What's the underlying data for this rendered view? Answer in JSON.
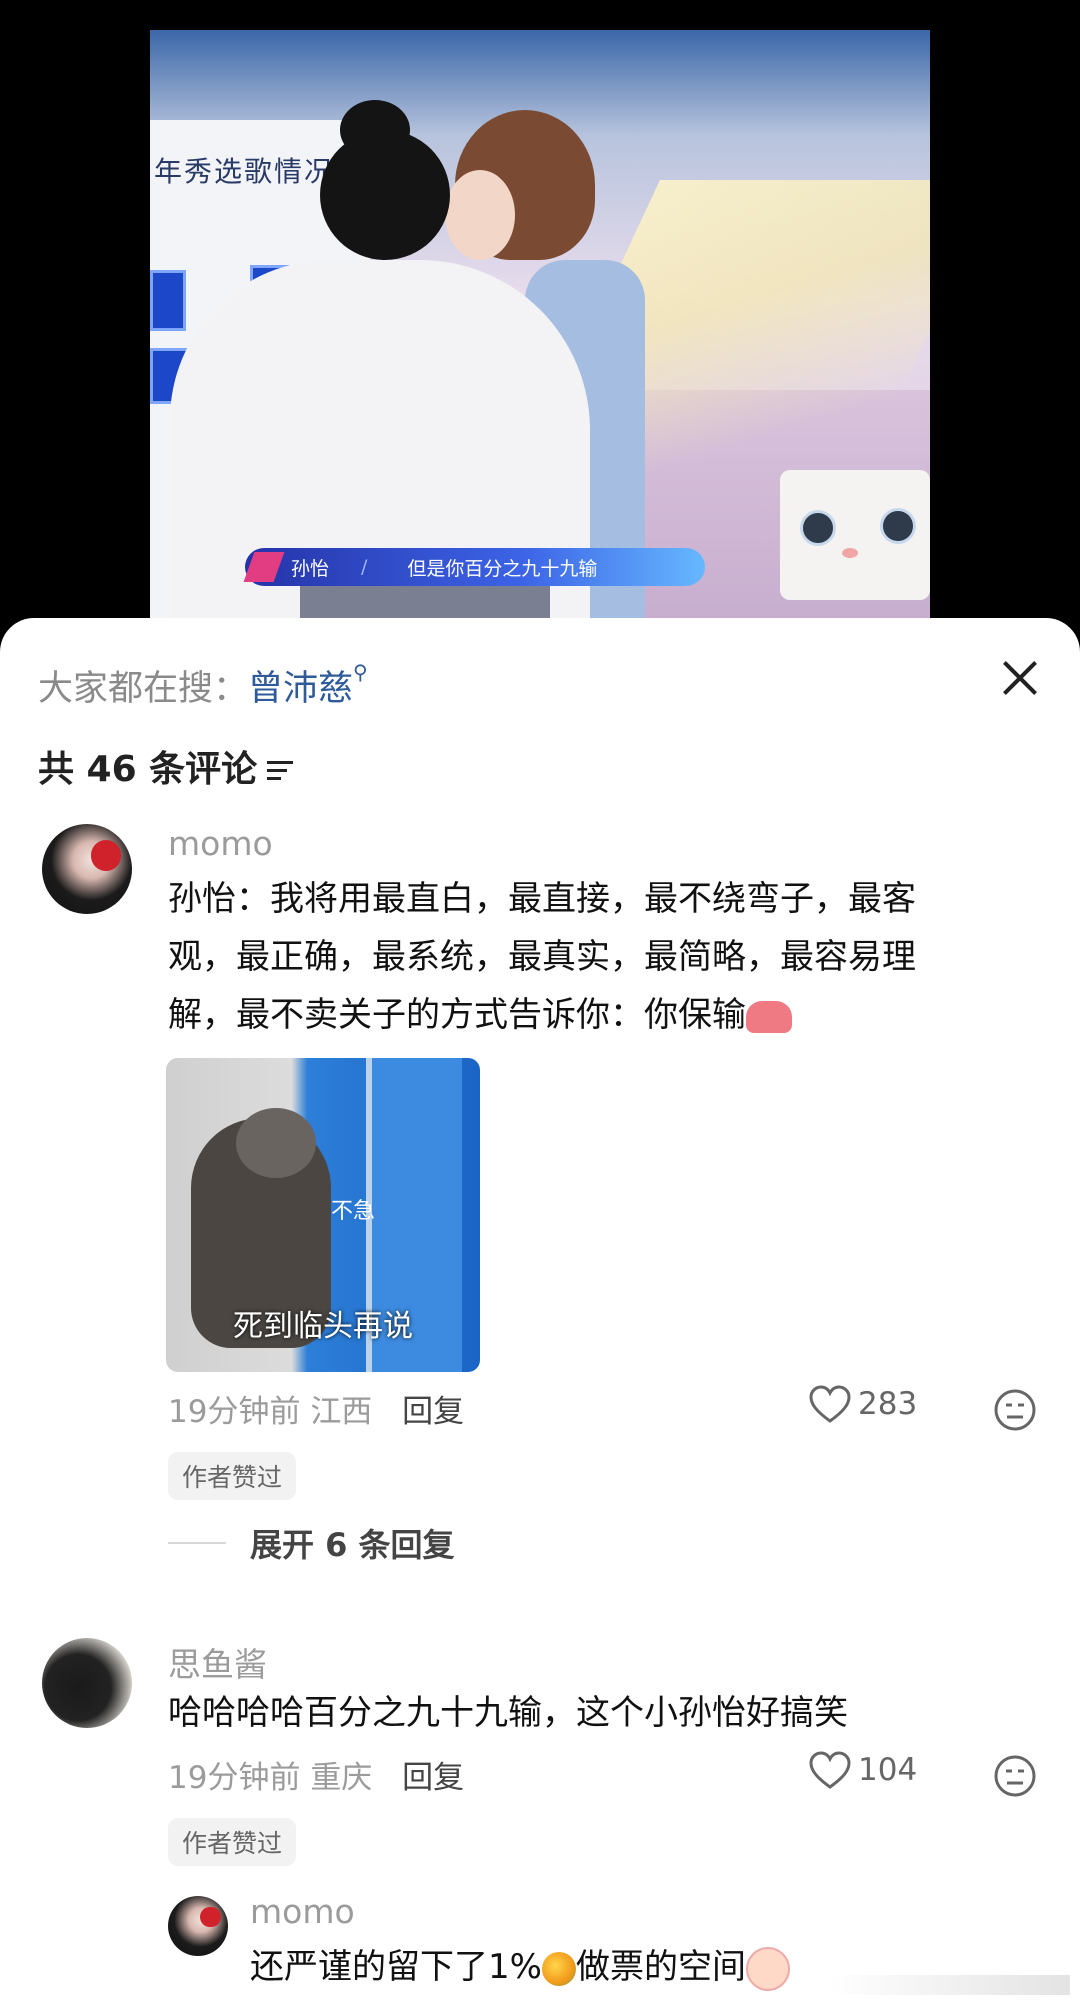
{
  "video": {
    "board_title": "年秀选歌情况",
    "board_vs": "VS",
    "caption_name": "孙怡",
    "caption_slash": "/",
    "caption_text": "但是你百分之九十九输"
  },
  "header": {
    "search_label": "大家都在搜：",
    "search_term": "曾沛慈",
    "comment_count": "共 46 条评论"
  },
  "comments": [
    {
      "username": "momo",
      "text_lines": [
        "孙怡：我将用最直白，最直接，最不绕弯子，最客",
        "观，最正确，最系统，最真实，最简略，最容易理",
        "解，最不卖关子的方式告诉你：你保输"
      ],
      "image_small_text": "不急",
      "image_big_text": "死到临头再说",
      "time": "19分钟前",
      "location": "江西",
      "reply_label": "回复",
      "likes": "283",
      "badge": "作者赞过",
      "expand_label": "展开 6 条回复"
    },
    {
      "username": "思鱼酱",
      "text": "哈哈哈哈百分之九十九输，这个小孙怡好搞笑",
      "time": "19分钟前",
      "location": "重庆",
      "reply_label": "回复",
      "likes": "104",
      "badge": "作者赞过",
      "reply": {
        "username": "momo",
        "text_a": "还严谨的留下了1%",
        "text_b": "做票的空间"
      }
    }
  ],
  "icons": {
    "close": "close-icon",
    "sort": "sort-icon",
    "like": "heart-icon",
    "dislike": "dislike-face-icon"
  }
}
